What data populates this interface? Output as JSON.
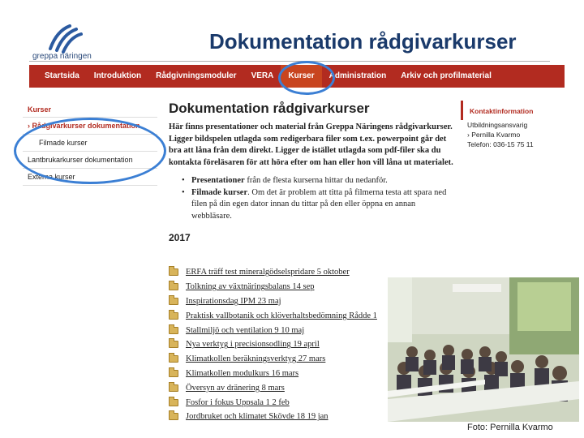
{
  "slide": {
    "title": "Dokumentation rådgivarkurser"
  },
  "logo": {
    "text": "greppa näringen",
    "color": "#2b5aa0"
  },
  "nav": {
    "items": [
      {
        "label": "Startsida"
      },
      {
        "label": "Introduktion"
      },
      {
        "label": "Rådgivningsmoduler"
      },
      {
        "label": "VERA"
      },
      {
        "label": "Kurser"
      },
      {
        "label": "Administration"
      },
      {
        "label": "Arkiv och profilmaterial"
      }
    ],
    "active_index": 4,
    "bar_color": "#b22b20"
  },
  "sidebar": {
    "heading": "Kurser",
    "items": [
      {
        "label": "› Rådgivarkurser dokumentation"
      },
      {
        "label": "Filmade kurser"
      },
      {
        "label": "Lantbrukarkurser dokumentation"
      },
      {
        "label": "Externa kurser"
      }
    ]
  },
  "main": {
    "title": "Dokumentation rådgivarkurser",
    "intro": "Här finns presentationer och material från Greppa Näringens rådgivarkurser. Ligger bildspelen utlagda som redigerbara filer som t.ex. powerpoint går det bra att låna från dem direkt. Ligger de istället utlagda som pdf-filer ska du kontakta föreläsaren för att höra efter om han eller hon vill låna ut materialet.",
    "bullets": [
      {
        "lead": "Presentationer",
        "text": " från de flesta kurserna hittar du nedanför."
      },
      {
        "lead": "Filmade kurser",
        "text": ". Om det är problem att titta på filmerna testa att spara ned filen på din egen dator innan du tittar på den eller öppna en annan webbläsare."
      }
    ],
    "year": "2017",
    "files": [
      "ERFA träff test mineralgödselspridare 5 oktober",
      "Tolkning av växtnäringsbalans 14 sep",
      "Inspirationsdag IPM 23 maj",
      "Praktisk vallbotanik och klöverhaltsbedömning Rådde 1",
      "Stallmiljö och ventilation 9 10 maj",
      "Nya verktyg i precisionsodling 19 april",
      "Klimatkollen beräkningsverktyg 27 mars",
      "Klimatkollen modulkurs 16 mars",
      "Översyn av dränering 8 mars",
      "Fosfor i fokus Uppsala 1 2 feb",
      "Jordbruket och klimatet Skövde 18 19 jan"
    ]
  },
  "contact": {
    "heading": "Kontaktinformation",
    "lines": [
      "Utbildningsansvarig",
      "› Pernilla Kvarmo",
      "Telefon: 036-15 75 11"
    ]
  },
  "photo": {
    "caption": "Foto: Pernilla Kvarmo"
  },
  "highlight_color": "#3b7fd4"
}
